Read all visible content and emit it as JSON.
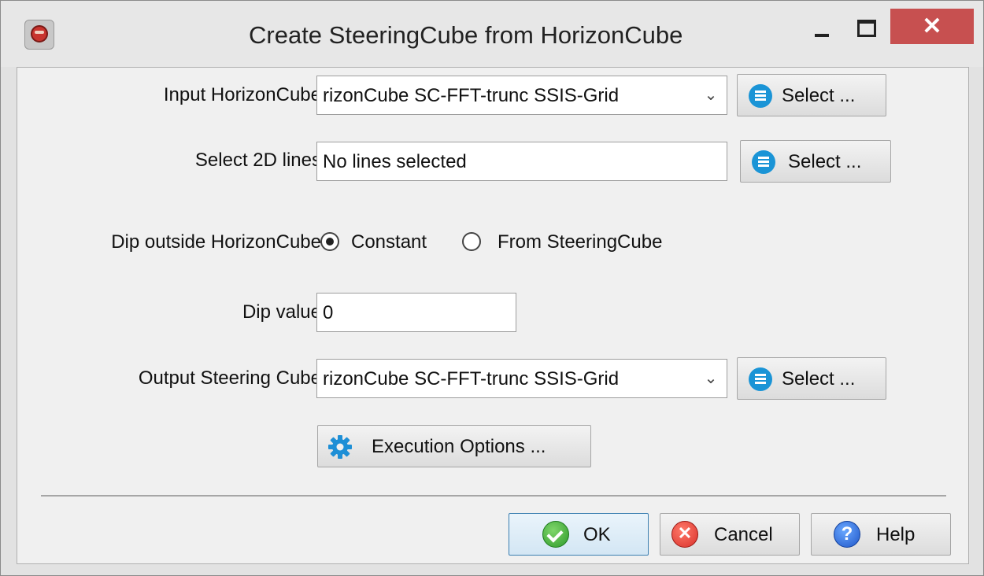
{
  "window": {
    "title": "Create SteeringCube from HorizonCube",
    "close_glyph": "✕"
  },
  "form": {
    "input_horizoncube": {
      "label": "Input HorizonCube",
      "value": "rizonCube SC-FFT-trunc SSIS-Grid",
      "arrow": "⌄",
      "select_label": "Select ..."
    },
    "select_2d_lines": {
      "label": "Select 2D lines",
      "value": "No lines selected",
      "select_label": "Select ..."
    },
    "dip_outside": {
      "label": "Dip outside HorizonCube",
      "options": [
        "Constant",
        "From SteeringCube"
      ],
      "selected": "Constant"
    },
    "dip_value": {
      "label": "Dip value",
      "value": "0"
    },
    "output_steering_cube": {
      "label": "Output Steering Cube",
      "value": "rizonCube SC-FFT-trunc SSIS-Grid",
      "arrow": "⌄",
      "select_label": "Select ..."
    },
    "execution_options_label": "Execution Options ..."
  },
  "buttons": {
    "ok": "OK",
    "cancel": "Cancel",
    "help": "Help",
    "cancel_glyph": "✕",
    "help_glyph": "?"
  },
  "icons": {
    "app": "app-icon",
    "select": "list-icon",
    "gear": "gear-icon",
    "ok": "check-icon",
    "cancel": "cancel-icon",
    "help": "help-icon"
  },
  "colors": {
    "accent": "#1a94d6",
    "close": "#c75050"
  }
}
